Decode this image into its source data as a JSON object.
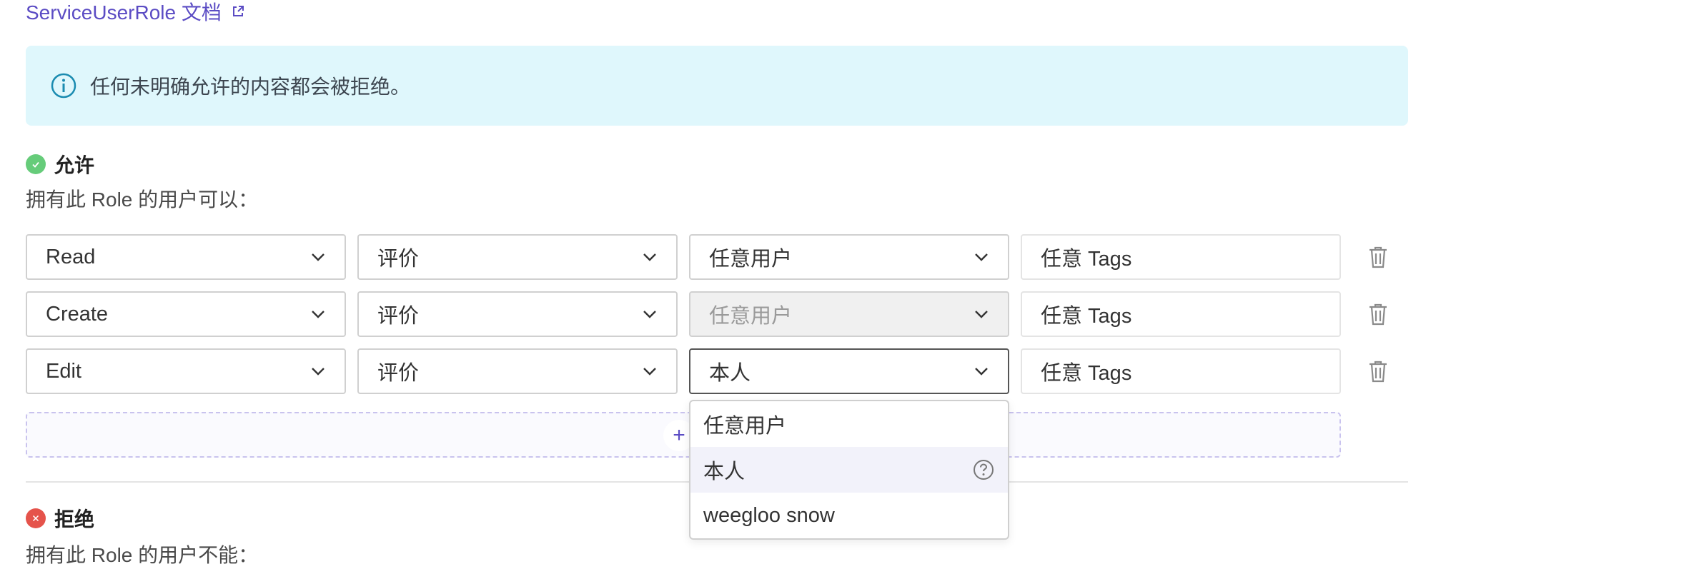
{
  "doc_link": "ServiceUserRole 文档",
  "info_text": "任何未明确允许的内容都会被拒绝。",
  "allow": {
    "title": "允许",
    "subtitle": "拥有此 Role 的用户可以："
  },
  "deny": {
    "title": "拒绝",
    "subtitle": "拥有此 Role 的用户不能："
  },
  "rules": [
    {
      "action": "Read",
      "resource": "评价",
      "owner": "任意用户",
      "tags": "任意 Tags"
    },
    {
      "action": "Create",
      "resource": "评价",
      "owner": "任意用户",
      "tags": "任意 Tags"
    },
    {
      "action": "Edit",
      "resource": "评价",
      "owner": "本人",
      "tags": "任意 Tags"
    }
  ],
  "add_rule": "+",
  "dropdown": {
    "options": [
      "任意用户",
      "本人",
      "weegloo snow"
    ],
    "highlighted": "本人"
  },
  "colors": {
    "accent": "#5b4cc4",
    "info_bg": "#dff7fc",
    "allow": "#66cc7a",
    "deny": "#e5534b"
  },
  "icons": {
    "info": "info-icon",
    "chevron": "chevron-down-icon",
    "trash": "trash-icon",
    "external": "external-link-icon",
    "help": "help-icon"
  }
}
